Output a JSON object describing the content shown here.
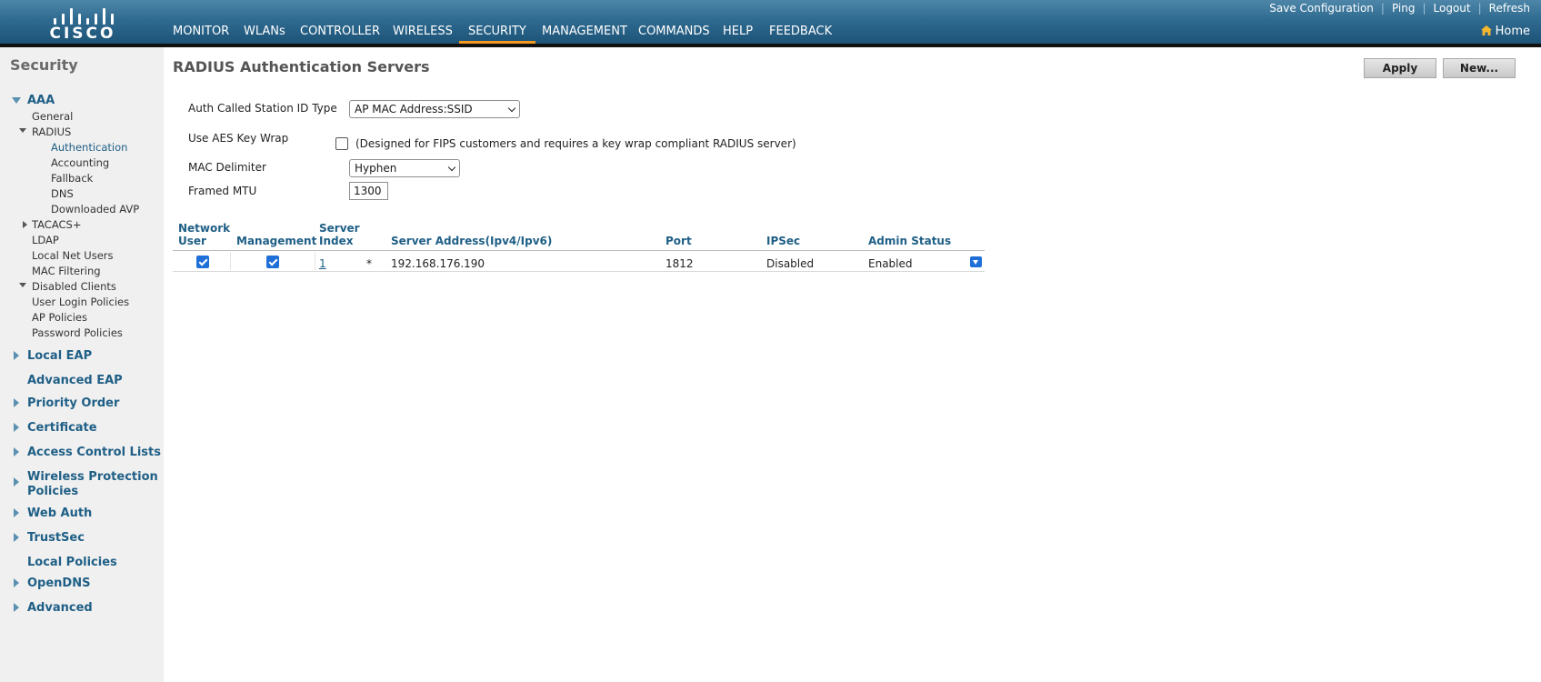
{
  "header": {
    "logo_text": "CISCO",
    "nav": [
      {
        "label": "MONITOR",
        "active": false
      },
      {
        "label": "WLANs",
        "active": false
      },
      {
        "label": "CONTROLLER",
        "active": false
      },
      {
        "label": "WIRELESS",
        "active": false
      },
      {
        "label": "SECURITY",
        "active": true
      },
      {
        "label": "MANAGEMENT",
        "active": false
      },
      {
        "label": "COMMANDS",
        "active": false
      },
      {
        "label": "HELP",
        "active": false
      },
      {
        "label": "FEEDBACK",
        "active": false
      }
    ],
    "top_links": {
      "save_configuration": "Save Configuration",
      "ping": "Ping",
      "logout": "Logout",
      "refresh": "Refresh",
      "separator": "|"
    },
    "home_label": "Home",
    "accent_color": "#f39b21"
  },
  "sidebar": {
    "title": "Security",
    "aaa": {
      "label": "AAA",
      "general": "General",
      "radius": {
        "label": "RADIUS",
        "items": [
          "Authentication",
          "Accounting",
          "Fallback",
          "DNS",
          "Downloaded AVP"
        ]
      },
      "items": [
        "TACACS+",
        "LDAP",
        "Local Net Users",
        "MAC Filtering",
        "Disabled Clients",
        "User Login Policies",
        "AP Policies",
        "Password Policies"
      ]
    },
    "sections": [
      "Local EAP",
      "Advanced EAP",
      "Priority Order",
      "Certificate",
      "Access Control Lists",
      "Wireless Protection",
      "Policies",
      "Web Auth",
      "TrustSec",
      "Local Policies",
      "OpenDNS",
      "Advanced"
    ]
  },
  "main": {
    "title": "RADIUS Authentication Servers",
    "apply_label": "Apply",
    "new_label": "New...",
    "form": {
      "auth_called_station_label": "Auth Called Station ID Type",
      "auth_called_station_value": "AP MAC Address:SSID",
      "aes_key_wrap_label": "Use AES Key Wrap",
      "aes_key_wrap_checked": false,
      "aes_key_wrap_note": "(Designed for FIPS customers and requires a key wrap compliant RADIUS server)",
      "mac_delimiter_label": "MAC Delimiter",
      "mac_delimiter_value": "Hyphen",
      "framed_mtu_label": "Framed MTU",
      "framed_mtu_value": "1300"
    },
    "table": {
      "headers": {
        "network_user_1": "Network",
        "network_user_2": "User",
        "management": "Management",
        "server_index_1": "Server",
        "server_index_2": "Index",
        "server_address": "Server Address(Ipv4/Ipv6)",
        "port": "Port",
        "ipsec": "IPSec",
        "admin_status": "Admin Status"
      },
      "rows": [
        {
          "network_user": true,
          "management": true,
          "index": "1",
          "marker": "*",
          "address": "192.168.176.190",
          "port": "1812",
          "ipsec": "Disabled",
          "admin_status": "Enabled"
        }
      ]
    }
  }
}
